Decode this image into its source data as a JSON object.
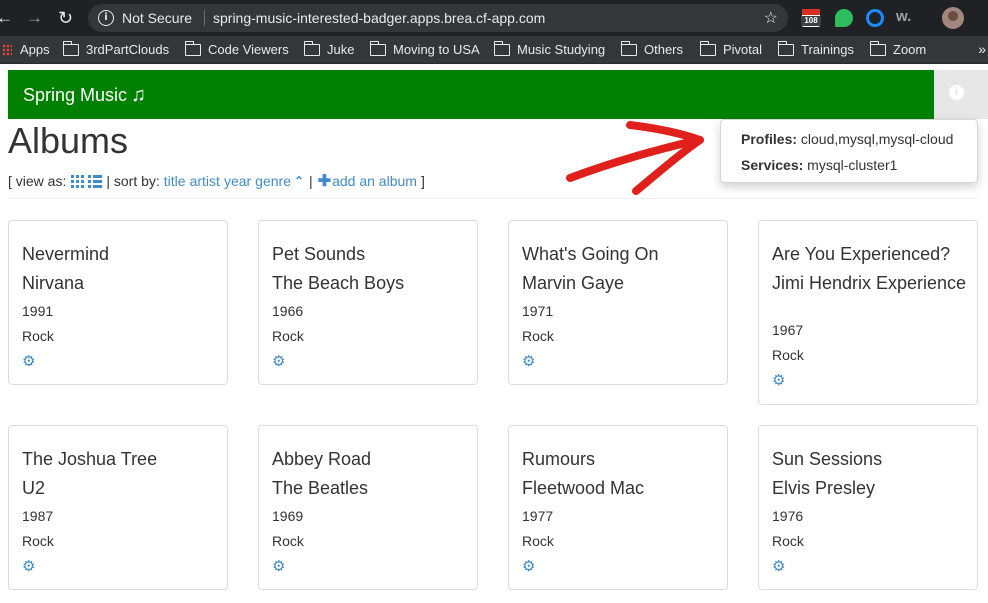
{
  "browser": {
    "security_label": "Not Secure",
    "url": "spring-music-interested-badger.apps.brea.cf-app.com",
    "calendar_badge": "108",
    "ext_w_label": "w.",
    "bookmarks": [
      "Apps",
      "3rdPartClouds",
      "Code Viewers",
      "Juke",
      "Moving to USA",
      "Music Studying",
      "Others",
      "Pivotal",
      "Trainings",
      "Zoom"
    ],
    "more_label": "»"
  },
  "app": {
    "brand": "Spring Music",
    "brand_symbol": "♫"
  },
  "popover": {
    "profiles_label": "Profiles:",
    "profiles_value": "cloud,mysql,mysql-cloud",
    "services_label": "Services:",
    "services_value": "mysql-cluster1"
  },
  "page": {
    "title": "Albums",
    "view_as_prefix": "[ view as:",
    "sort_sep": "| sort by:",
    "sort_title": "title",
    "sort_artist": "artist",
    "sort_year": "year",
    "sort_genre": "genre",
    "add_sep": "|",
    "add_label": "add an album",
    "close_bracket": "]"
  },
  "albums": [
    {
      "title": "Nevermind",
      "artist": "Nirvana",
      "year": "1991",
      "genre": "Rock"
    },
    {
      "title": "Pet Sounds",
      "artist": "The Beach Boys",
      "year": "1966",
      "genre": "Rock"
    },
    {
      "title": "What's Going On",
      "artist": "Marvin Gaye",
      "year": "1971",
      "genre": "Rock"
    },
    {
      "title": "Are You Experienced?",
      "artist": "Jimi Hendrix Experience",
      "year": "1967",
      "genre": "Rock"
    },
    {
      "title": "The Joshua Tree",
      "artist": "U2",
      "year": "1987",
      "genre": "Rock"
    },
    {
      "title": "Abbey Road",
      "artist": "The Beatles",
      "year": "1969",
      "genre": "Rock"
    },
    {
      "title": "Rumours",
      "artist": "Fleetwood Mac",
      "year": "1977",
      "genre": "Rock"
    },
    {
      "title": "Sun Sessions",
      "artist": "Elvis Presley",
      "year": "1976",
      "genre": "Rock"
    }
  ],
  "colors": {
    "navbar": "#008000",
    "link": "#428bca",
    "annotation_arrow": "#e0201b"
  }
}
